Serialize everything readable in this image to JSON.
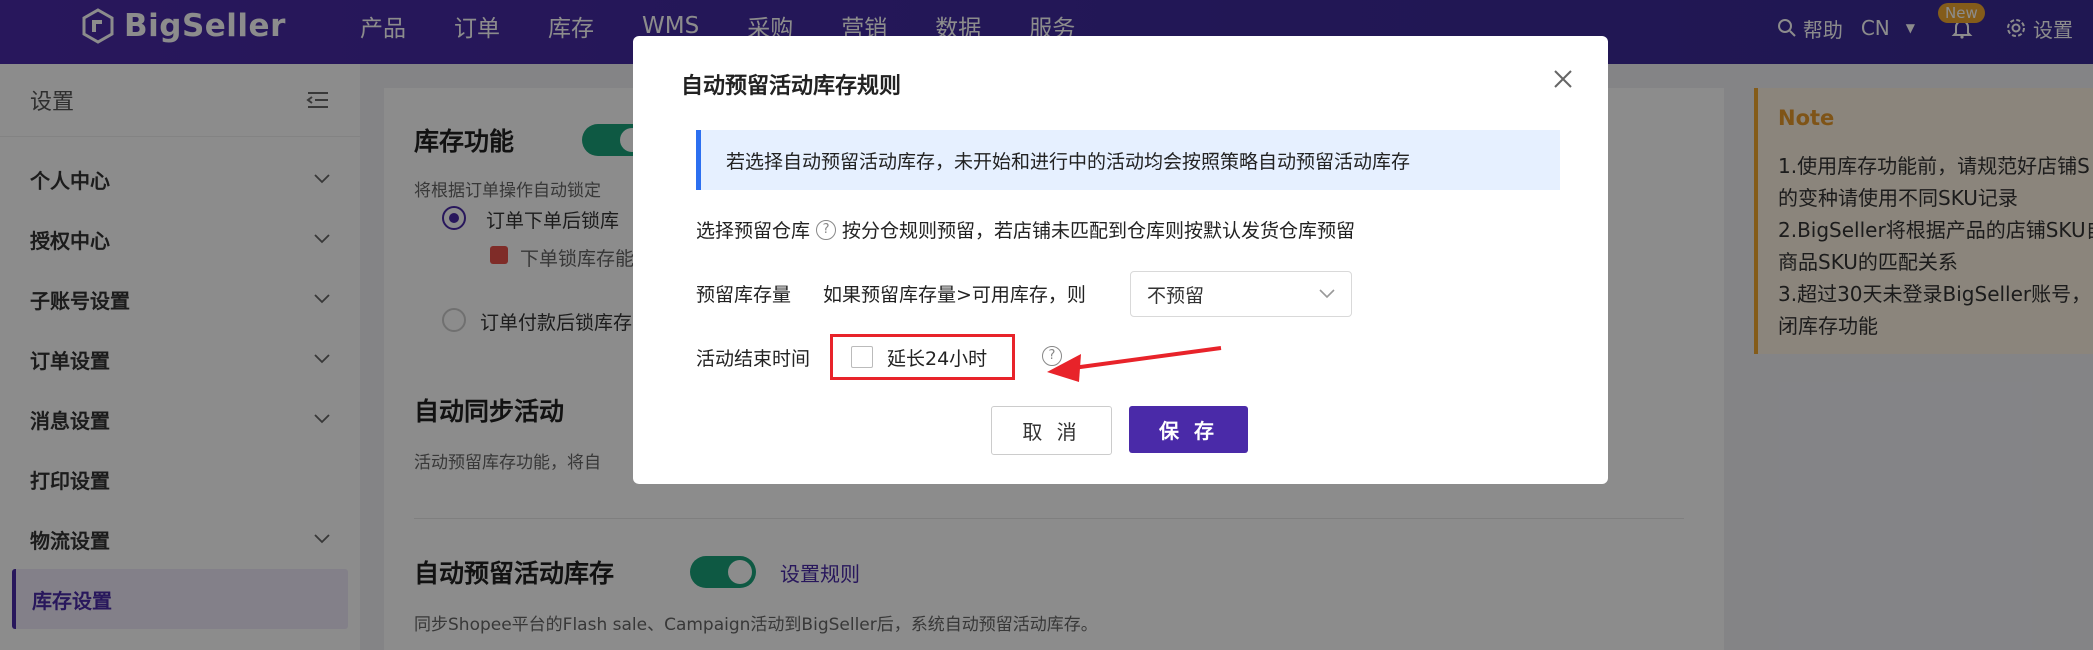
{
  "brand": {
    "name": "BigSeller"
  },
  "nav": {
    "items": [
      "产品",
      "订单",
      "库存",
      "WMS",
      "采购",
      "营销",
      "数据",
      "服务"
    ],
    "help": "帮助",
    "lang": "CN",
    "new_badge": "New",
    "settings": "设置"
  },
  "sidebar": {
    "title": "设置",
    "items": [
      {
        "label": "个人中心",
        "has_chevron": true
      },
      {
        "label": "授权中心",
        "has_chevron": true
      },
      {
        "label": "子账号设置",
        "has_chevron": true
      },
      {
        "label": "订单设置",
        "has_chevron": true
      },
      {
        "label": "消息设置",
        "has_chevron": true
      },
      {
        "label": "打印设置",
        "has_chevron": false
      },
      {
        "label": "物流设置",
        "has_chevron": true
      },
      {
        "label": "库存设置",
        "has_chevron": false,
        "active": true
      }
    ]
  },
  "main": {
    "inventory_title": "库存功能",
    "inventory_desc": "将根据订单操作自动锁定",
    "radio1": "订单下单后锁库",
    "radio1_sub": "下单锁库存能",
    "radio2": "订单付款后锁库存",
    "sync_title": "自动同步活动",
    "sync_desc": "活动预留库存功能，将自",
    "reserve_title": "自动预留活动库存",
    "reserve_link": "设置规则",
    "reserve_desc": "同步Shopee平台的Flash sale、Campaign活动到BigSeller后，系统自动预留活动库存。"
  },
  "note": {
    "title": "Note",
    "lines": [
      "1.使用库存功能前，请规范好店铺S",
      "的变种请使用不同SKU记录",
      "2.BigSeller将根据产品的店铺SKU自",
      "商品SKU的匹配关系",
      "3.超过30天未登录BigSeller账号，",
      "闭库存功能"
    ]
  },
  "modal": {
    "title": "自动预留活动库存规则",
    "info": "若选择自动预留活动库存，未开始和进行中的活动均会按照策略自动预留活动库存",
    "warehouse_label": "选择预留仓库",
    "warehouse_value": "按分仓规则预留，若店铺未匹配到仓库则按默认发货仓库预留",
    "qty_label": "预留库存量",
    "qty_condition": "如果预留库存量>可用库存，则",
    "qty_select": "不预留",
    "end_label": "活动结束时间",
    "extend_label": "延长24小时",
    "cancel": "取 消",
    "save": "保 存"
  },
  "colors": {
    "brand": "#4a2aa8",
    "highlight": "#e8232a",
    "toggle_on": "#1aa37a",
    "note_accent": "#f0a830"
  }
}
